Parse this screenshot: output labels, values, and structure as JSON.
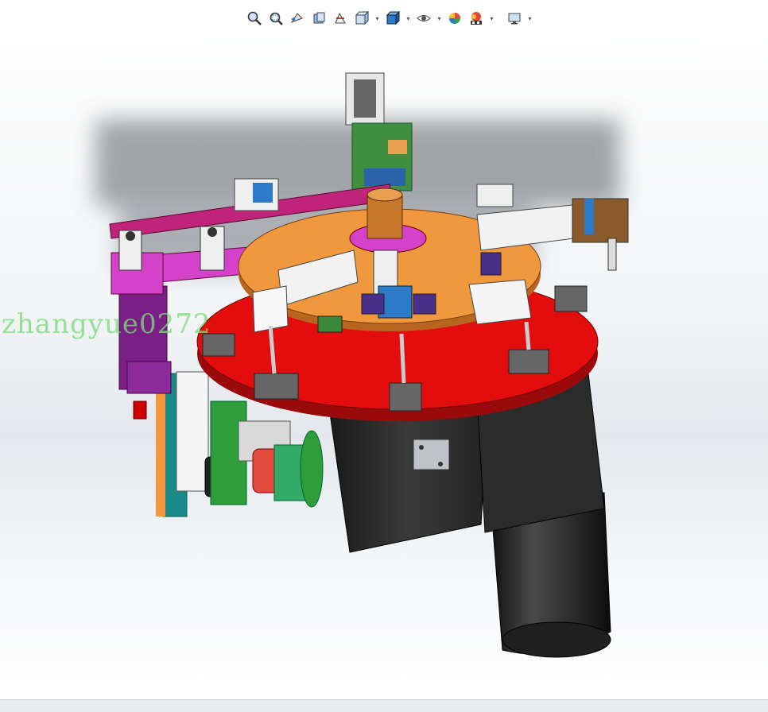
{
  "app": {
    "name": "SolidWorks 3D assembly viewport"
  },
  "toolbar": {
    "buttons": [
      {
        "name": "zoom-to-fit-icon",
        "has_dropdown": false
      },
      {
        "name": "zoom-to-area-icon",
        "has_dropdown": false
      },
      {
        "name": "previous-view-icon",
        "has_dropdown": false
      },
      {
        "name": "section-view-icon",
        "has_dropdown": false
      },
      {
        "name": "dynamic-annotation-icon",
        "has_dropdown": false
      },
      {
        "name": "view-orientation-icon",
        "has_dropdown": true
      },
      {
        "name": "display-style-icon",
        "has_dropdown": true
      },
      {
        "name": "hide-show-items-icon",
        "has_dropdown": true
      },
      {
        "name": "edit-appearance-icon",
        "has_dropdown": false
      },
      {
        "name": "apply-scene-icon",
        "has_dropdown": true
      },
      {
        "name": "view-settings-icon",
        "has_dropdown": true
      }
    ]
  },
  "watermark": {
    "text": "zhangyue0272"
  },
  "colors": {
    "turntable_red": "#e40d0d",
    "turntable_orange": "#f0983e",
    "motor_black": "#2a2a2a",
    "frame_purple": "#7a1f86",
    "frame_magenta": "#d542c9",
    "frame_pink": "#c0237a",
    "gear_green": "#2e9e3a",
    "coupling_red": "#e24a3a",
    "rail_white": "#f2f2f2",
    "steel_blue": "#2c7ac8",
    "watermark_green": "#78dc78"
  }
}
